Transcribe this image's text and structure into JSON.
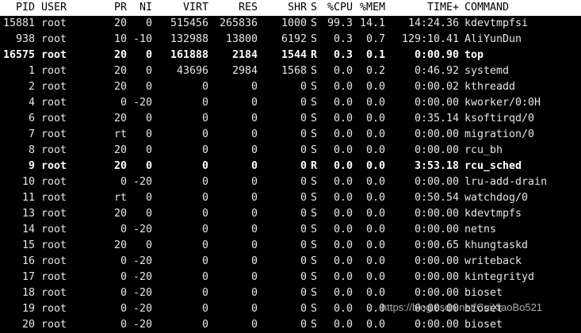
{
  "header": {
    "pid": "PID",
    "user": "USER",
    "pr": "PR",
    "ni": "NI",
    "virt": "VIRT",
    "res": "RES",
    "shr": "SHR",
    "s": "S",
    "cpu": "%CPU",
    "mem": "%MEM",
    "time": "TIME+",
    "cmd": "COMMAND"
  },
  "colors": {
    "background": "#000000",
    "text": "#e6e6e6",
    "header_bg": "#ffffff",
    "header_text": "#000000"
  },
  "processes": [
    {
      "pid": "15881",
      "user": "root",
      "pr": "20",
      "ni": "0",
      "virt": "515456",
      "res": "265836",
      "shr": "1000",
      "s": "S",
      "cpu": "99.3",
      "mem": "14.1",
      "time": "14:24.36",
      "cmd": "kdevtmpfsi",
      "bold": false
    },
    {
      "pid": "938",
      "user": "root",
      "pr": "10",
      "ni": "-10",
      "virt": "132988",
      "res": "13800",
      "shr": "6192",
      "s": "S",
      "cpu": "0.3",
      "mem": "0.7",
      "time": "129:10.41",
      "cmd": "AliYunDun",
      "bold": false
    },
    {
      "pid": "16575",
      "user": "root",
      "pr": "20",
      "ni": "0",
      "virt": "161888",
      "res": "2184",
      "shr": "1544",
      "s": "R",
      "cpu": "0.3",
      "mem": "0.1",
      "time": "0:00.90",
      "cmd": "top",
      "bold": true
    },
    {
      "pid": "1",
      "user": "root",
      "pr": "20",
      "ni": "0",
      "virt": "43696",
      "res": "2984",
      "shr": "1568",
      "s": "S",
      "cpu": "0.0",
      "mem": "0.2",
      "time": "0:46.92",
      "cmd": "systemd",
      "bold": false
    },
    {
      "pid": "2",
      "user": "root",
      "pr": "20",
      "ni": "0",
      "virt": "0",
      "res": "0",
      "shr": "0",
      "s": "S",
      "cpu": "0.0",
      "mem": "0.0",
      "time": "0:00.02",
      "cmd": "kthreadd",
      "bold": false
    },
    {
      "pid": "4",
      "user": "root",
      "pr": "0",
      "ni": "-20",
      "virt": "0",
      "res": "0",
      "shr": "0",
      "s": "S",
      "cpu": "0.0",
      "mem": "0.0",
      "time": "0:00.00",
      "cmd": "kworker/0:0H",
      "bold": false
    },
    {
      "pid": "6",
      "user": "root",
      "pr": "20",
      "ni": "0",
      "virt": "0",
      "res": "0",
      "shr": "0",
      "s": "S",
      "cpu": "0.0",
      "mem": "0.0",
      "time": "0:35.14",
      "cmd": "ksoftirqd/0",
      "bold": false
    },
    {
      "pid": "7",
      "user": "root",
      "pr": "rt",
      "ni": "0",
      "virt": "0",
      "res": "0",
      "shr": "0",
      "s": "S",
      "cpu": "0.0",
      "mem": "0.0",
      "time": "0:00.00",
      "cmd": "migration/0",
      "bold": false
    },
    {
      "pid": "8",
      "user": "root",
      "pr": "20",
      "ni": "0",
      "virt": "0",
      "res": "0",
      "shr": "0",
      "s": "S",
      "cpu": "0.0",
      "mem": "0.0",
      "time": "0:00.00",
      "cmd": "rcu_bh",
      "bold": false
    },
    {
      "pid": "9",
      "user": "root",
      "pr": "20",
      "ni": "0",
      "virt": "0",
      "res": "0",
      "shr": "0",
      "s": "R",
      "cpu": "0.0",
      "mem": "0.0",
      "time": "3:53.18",
      "cmd": "rcu_sched",
      "bold": true
    },
    {
      "pid": "10",
      "user": "root",
      "pr": "0",
      "ni": "-20",
      "virt": "0",
      "res": "0",
      "shr": "0",
      "s": "S",
      "cpu": "0.0",
      "mem": "0.0",
      "time": "0:00.00",
      "cmd": "lru-add-drain",
      "bold": false
    },
    {
      "pid": "11",
      "user": "root",
      "pr": "rt",
      "ni": "0",
      "virt": "0",
      "res": "0",
      "shr": "0",
      "s": "S",
      "cpu": "0.0",
      "mem": "0.0",
      "time": "0:50.54",
      "cmd": "watchdog/0",
      "bold": false
    },
    {
      "pid": "13",
      "user": "root",
      "pr": "20",
      "ni": "0",
      "virt": "0",
      "res": "0",
      "shr": "0",
      "s": "S",
      "cpu": "0.0",
      "mem": "0.0",
      "time": "0:00.00",
      "cmd": "kdevtmpfs",
      "bold": false
    },
    {
      "pid": "14",
      "user": "root",
      "pr": "0",
      "ni": "-20",
      "virt": "0",
      "res": "0",
      "shr": "0",
      "s": "S",
      "cpu": "0.0",
      "mem": "0.0",
      "time": "0:00.00",
      "cmd": "netns",
      "bold": false
    },
    {
      "pid": "15",
      "user": "root",
      "pr": "20",
      "ni": "0",
      "virt": "0",
      "res": "0",
      "shr": "0",
      "s": "S",
      "cpu": "0.0",
      "mem": "0.0",
      "time": "0:00.65",
      "cmd": "khungtaskd",
      "bold": false
    },
    {
      "pid": "16",
      "user": "root",
      "pr": "0",
      "ni": "-20",
      "virt": "0",
      "res": "0",
      "shr": "0",
      "s": "S",
      "cpu": "0.0",
      "mem": "0.0",
      "time": "0:00.00",
      "cmd": "writeback",
      "bold": false
    },
    {
      "pid": "17",
      "user": "root",
      "pr": "0",
      "ni": "-20",
      "virt": "0",
      "res": "0",
      "shr": "0",
      "s": "S",
      "cpu": "0.0",
      "mem": "0.0",
      "time": "0:00.00",
      "cmd": "kintegrityd",
      "bold": false
    },
    {
      "pid": "18",
      "user": "root",
      "pr": "0",
      "ni": "-20",
      "virt": "0",
      "res": "0",
      "shr": "0",
      "s": "S",
      "cpu": "0.0",
      "mem": "0.0",
      "time": "0:00.00",
      "cmd": "bioset",
      "bold": false
    },
    {
      "pid": "19",
      "user": "root",
      "pr": "0",
      "ni": "-20",
      "virt": "0",
      "res": "0",
      "shr": "0",
      "s": "S",
      "cpu": "0.0",
      "mem": "0.0",
      "time": "0:00.00",
      "cmd": "bioset",
      "bold": false
    },
    {
      "pid": "20",
      "user": "root",
      "pr": "0",
      "ni": "-20",
      "virt": "0",
      "res": "0",
      "shr": "0",
      "s": "S",
      "cpu": "0.0",
      "mem": "0.0",
      "time": "0:00.00",
      "cmd": "bioset",
      "bold": false
    }
  ],
  "watermark": "https://blog.csdn.net/CuiXiaoBo521"
}
